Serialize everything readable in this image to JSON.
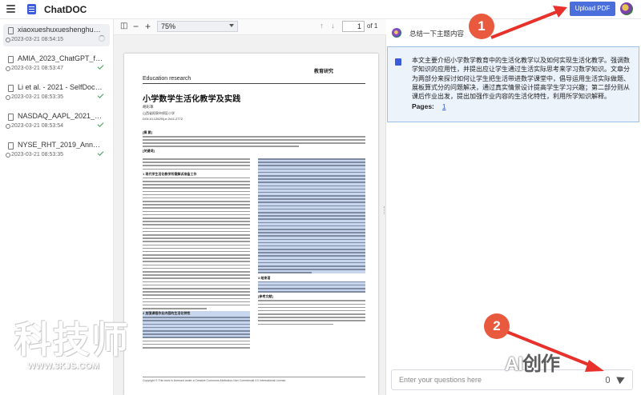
{
  "app": {
    "title": "ChatDOC",
    "upload_button": "Upload PDF"
  },
  "sidebar": {
    "items": [
      {
        "name": "xiaoxueshuxueshenghuoh...",
        "time": "2023-03-21 08:54:15",
        "status": "processing",
        "active": true
      },
      {
        "name": "AMIA_2023_ChatGPT_for...",
        "time": "2023-03-21 08:53:47",
        "status": "done"
      },
      {
        "name": "Li et al. - 2021 - SelfDoc S...",
        "time": "2023-03-21 08:53:35",
        "status": "done"
      },
      {
        "name": "NASDAQ_AAPL_2021_An...",
        "time": "2023-03-21 08:53:54",
        "status": "done"
      },
      {
        "name": "NYSE_RHT_2019_Annual...",
        "time": "2023-03-21 08:53:35",
        "status": "done"
      }
    ]
  },
  "pdf_toolbar": {
    "zoom": "75%",
    "page_current": "1",
    "page_total": "of 1"
  },
  "pdf_page": {
    "journal": "Education research",
    "masthead": "教育研究",
    "title": "小学数学生活化教学及实践",
    "author": "胡彩革",
    "affiliation": "山西省阳泉市郊区小学",
    "doi": "DOI:10.12629/j.rr.2x11.2772",
    "abstract_label": "[摘 要]",
    "keywords_label": "[关键词]",
    "section1": "1 现代学生活化教学所需解诉准备工作",
    "section2": "2 加强课程作业内容的生活化特性",
    "section3": "3 结束语",
    "references": "[参考文献]",
    "footer": "Copyright © This work is licensed under a Creative Commons Attribution-Non Commercial 4.0 International License."
  },
  "chat": {
    "question": "总结一下主题内容",
    "answer": "本文主要介绍小学数学教育中的生活化教学以及如何实现生活化教学。强调数学知识的应用性，并提出应让学生通过生活实际思考来学习数学知识。文章分为两部分来探讨如何让学生把生活带进数学课堂中，倡导运用生活实际做题、展板算式分的问题解决，通过真实情景设计提高学生学习兴趣；第二部分则从课后作业出发，提出加强作业内容的生活化特性，利用所学知识解释。",
    "pages_label": "Pages:",
    "pages_link": "1",
    "input_placeholder": "Enter your questions here"
  },
  "annotations": {
    "badge1": "1",
    "badge2": "2"
  },
  "watermarks": {
    "left_chars": "科技师",
    "left_url": "WWW.3KJS.COM",
    "right_mark": "AI",
    "right_text": "创作"
  },
  "colors": {
    "accent": "#4a6fdc",
    "highlight": "#c7d6ee",
    "answer_bg": "#ecf3fb",
    "badge": "#e8593d",
    "check": "#40a05a"
  },
  "icons": [
    "menu-icon",
    "logo-icon",
    "file-icon",
    "clock-icon",
    "check-icon",
    "spinner-icon",
    "sidebar-toggle-icon",
    "zoom-out-icon",
    "zoom-in-icon",
    "up-arrow-icon",
    "down-arrow-icon",
    "bot-icon",
    "mic-icon",
    "send-icon"
  ]
}
